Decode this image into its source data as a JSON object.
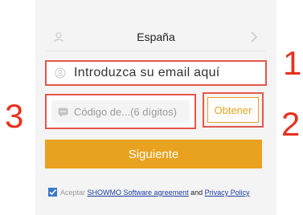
{
  "country": {
    "value": "España"
  },
  "email": {
    "placeholder": "Introduzca su email aquí"
  },
  "code": {
    "placeholder": "Código de...(6 dígitos)",
    "button_label": "Obtener"
  },
  "next_button": {
    "label": "Siguiente"
  },
  "agreement": {
    "prefix": "Aceptar",
    "software_link": "SHOWMO Software agreement",
    "and": "and",
    "privacy_link": "Privacy Policy",
    "checked": true
  },
  "annotations": {
    "one": "1",
    "two": "2",
    "three": "3"
  },
  "colors": {
    "accent": "#e9a21f",
    "annotation_red": "#e8311f",
    "link": "#1a3ea3"
  }
}
